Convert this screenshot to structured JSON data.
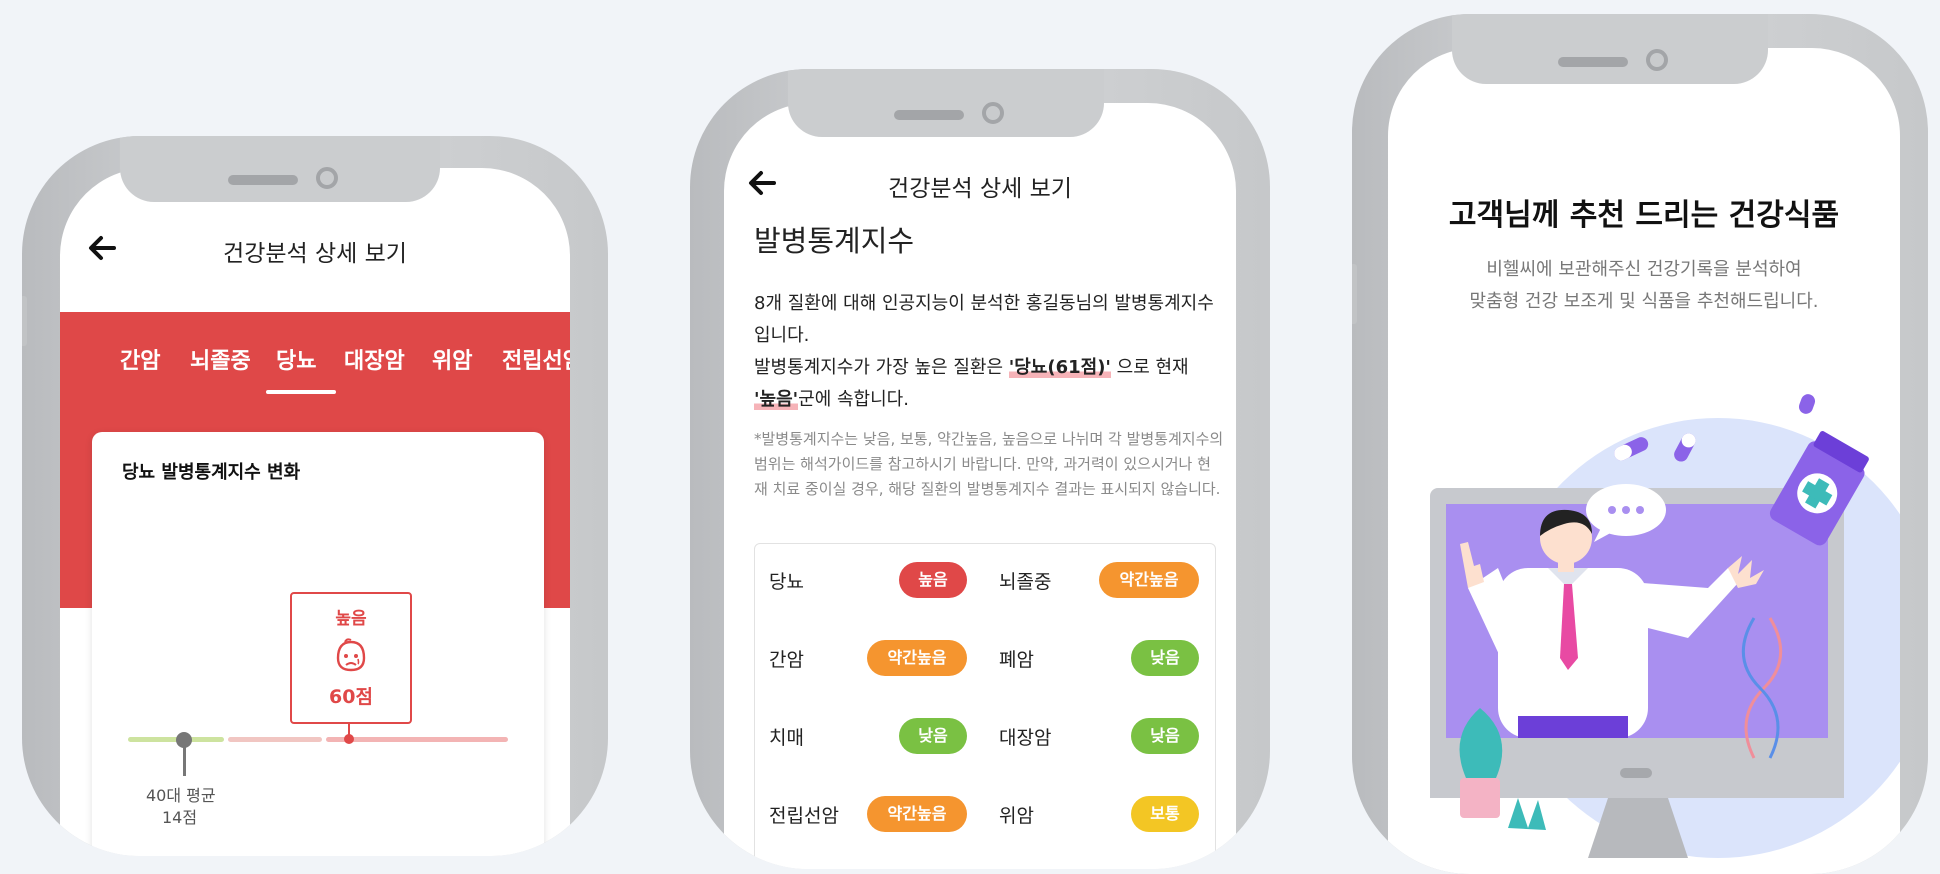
{
  "colors": {
    "brand_red": "#df4848",
    "high": "#e04848",
    "slightly_high": "#f5952f",
    "low": "#7ac143",
    "caution": "#f3c624"
  },
  "phone1": {
    "header_title": "건강분석 상세 보기",
    "back_icon": "back-arrow-icon",
    "tabs": [
      "간암",
      "뇌졸중",
      "당뇨",
      "대장암",
      "위암",
      "전립선암"
    ],
    "active_tab": "당뇨",
    "card_title": "당뇨 발병통계지수 변화",
    "marker": {
      "level": "높음",
      "score": "60점",
      "icon": "sad-face-icon"
    },
    "avg_label": "40대 평균",
    "avg_score": "14점"
  },
  "phone2": {
    "header_title": "건강분석 상세 보기",
    "back_icon": "back-arrow-icon",
    "section_title": "발병통계지수",
    "desc_line1": "8개 질환에 대해 인공지능이 분석한 홍길동님의 발병통계지수 입니다.",
    "desc_line2_pre": "발병통계지수가 가장 높은 질환은 ",
    "desc_line2_hl": "'당뇨(61점)'",
    "desc_line2_mid": " 으로 현재 ",
    "desc_line2_hl2": "'높음'",
    "desc_line2_post": "군에 속합니다.",
    "note": "*발병통계지수는 낮음, 보통, 약간높음, 높음으로 나뉘며 각 발병통계지수의 범위는 해석가이드를 참고하시기 바랍니다. 만약, 과거력이 있으시거나 현재 치료 중이실 경우, 해당 질환의 발병통계지수 결과는 표시되지 않습니다.",
    "diseases": [
      {
        "name": "당뇨",
        "level": "높음"
      },
      {
        "name": "뇌졸중",
        "level": "약간높음"
      },
      {
        "name": "간암",
        "level": "약간높음"
      },
      {
        "name": "폐암",
        "level": "낮음"
      },
      {
        "name": "치매",
        "level": "낮음"
      },
      {
        "name": "대장암",
        "level": "낮음"
      },
      {
        "name": "전립선암",
        "level": "약간높음"
      },
      {
        "name": "위암",
        "level": "보통"
      }
    ]
  },
  "phone3": {
    "title": "고객님께 추천 드리는 건강식품",
    "subtitle_1": "비헬씨에 보관해주신 건강기록을 분석하여",
    "subtitle_2": "맞춤형 건강 보조게 및 식품을 추천해드립니다."
  }
}
